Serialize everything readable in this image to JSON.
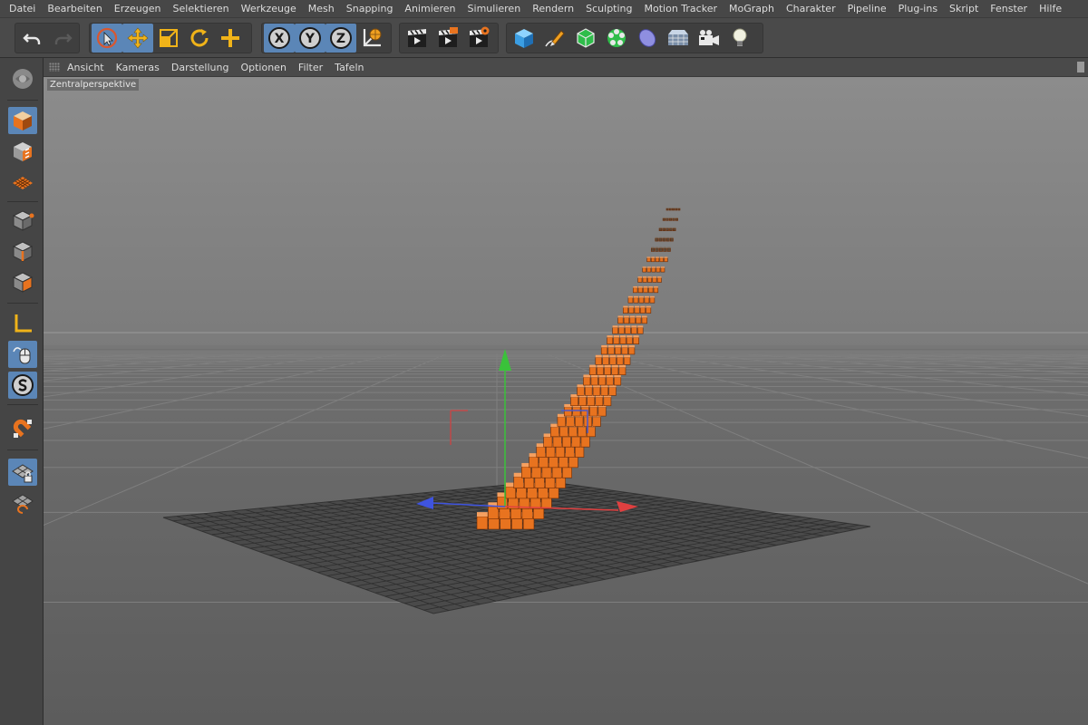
{
  "menubar": {
    "items": [
      "Datei",
      "Bearbeiten",
      "Erzeugen",
      "Selektieren",
      "Werkzeuge",
      "Mesh",
      "Snapping",
      "Animieren",
      "Simulieren",
      "Rendern",
      "Sculpting",
      "Motion Tracker",
      "MoGraph",
      "Charakter",
      "Pipeline",
      "Plug-ins",
      "Skript",
      "Fenster",
      "Hilfe"
    ]
  },
  "toolbar": {
    "undo_icon": "undo-icon",
    "redo_icon": "redo-icon",
    "tools": [
      "live-selection-icon",
      "move-icon",
      "scale-icon",
      "rotate-icon",
      "recent-tool-icon"
    ],
    "axes": [
      "X",
      "Y",
      "Z"
    ],
    "coord_icon": "world-coordinates-icon",
    "render": [
      "render-view-icon",
      "render-picture-viewer-icon",
      "render-settings-icon"
    ],
    "objects": [
      "cube-icon",
      "pen-icon",
      "subdivision-icon",
      "cloner-icon",
      "deformer-icon",
      "floor-icon",
      "camera-icon",
      "light-icon"
    ]
  },
  "leftbar": {
    "tools": [
      "make-editable-icon",
      "model-mode-icon",
      "texture-mode-icon",
      "points-mode-icon",
      "edges-mode-icon",
      "polygons-mode-icon",
      "axis-mode-icon",
      "tweak-mode-icon",
      "solo-icon",
      "snap-icon",
      "workplane-lock-icon",
      "workplane-icon"
    ]
  },
  "viewport": {
    "menu": [
      "Ansicht",
      "Kameras",
      "Darstellung",
      "Optionen",
      "Filter",
      "Tafeln"
    ],
    "label": "Zentralperspektive"
  },
  "colors": {
    "accent": "#5b86b7",
    "clone": "#e8731f",
    "axis_x": "#e04040",
    "axis_y": "#3ac23a",
    "axis_z": "#3f54e0"
  }
}
